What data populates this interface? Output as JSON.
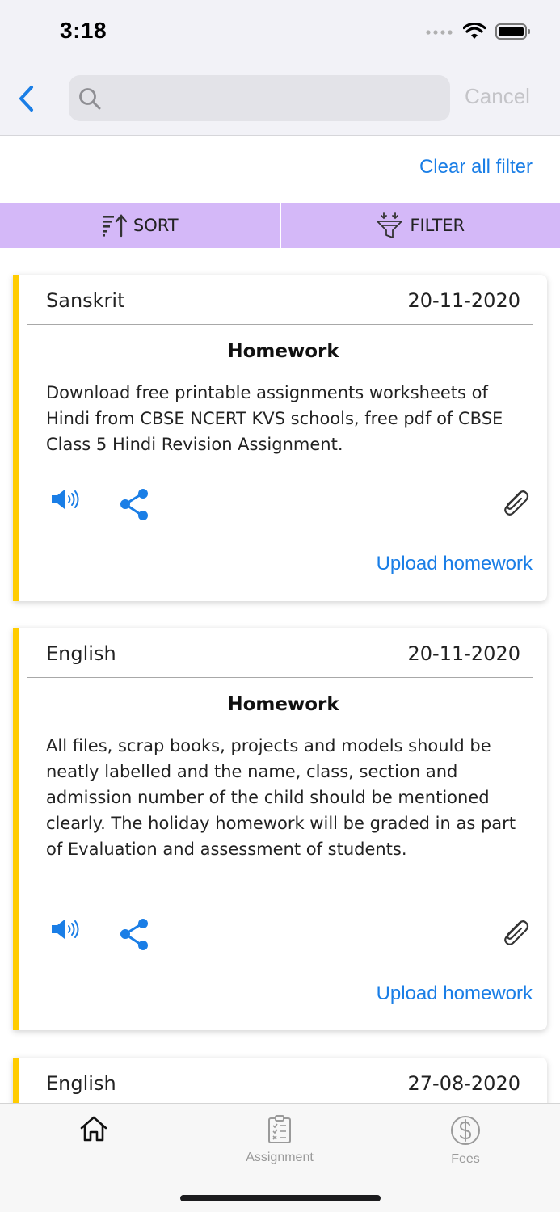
{
  "status": {
    "time": "3:18"
  },
  "search": {
    "placeholder": "",
    "cancel_label": "Cancel"
  },
  "filters": {
    "clear_label": "Clear all filter",
    "sort_label": "SORT",
    "filter_label": "FILTER"
  },
  "cards": [
    {
      "subject": "Sanskrit",
      "date": "20-11-2020",
      "type": "Homework",
      "description": "Download free printable assignments worksheets of Hindi from CBSE NCERT KVS schools, free pdf of CBSE Class 5 Hindi Revision Assignment.",
      "upload_label": "Upload homework"
    },
    {
      "subject": "English",
      "date": "20-11-2020",
      "type": "Homework",
      "description": "All files, scrap books, projects and models should be neatly labelled and the name, class, section and admission number of the child should be mentioned clearly. The holiday homework will be graded in as part of Evaluation and assessment of students.",
      "upload_label": "Upload homework"
    },
    {
      "subject": "English",
      "date": "27-08-2020"
    }
  ],
  "tabs": [
    {
      "label": "",
      "icon": "home-icon"
    },
    {
      "label": "Assignment",
      "icon": "clipboard-icon"
    },
    {
      "label": "Fees",
      "icon": "dollar-icon"
    }
  ],
  "colors": {
    "accent": "#1a7ee6",
    "card_stripe": "#ffcc00",
    "toolbar_bg": "#d4b8f8"
  }
}
